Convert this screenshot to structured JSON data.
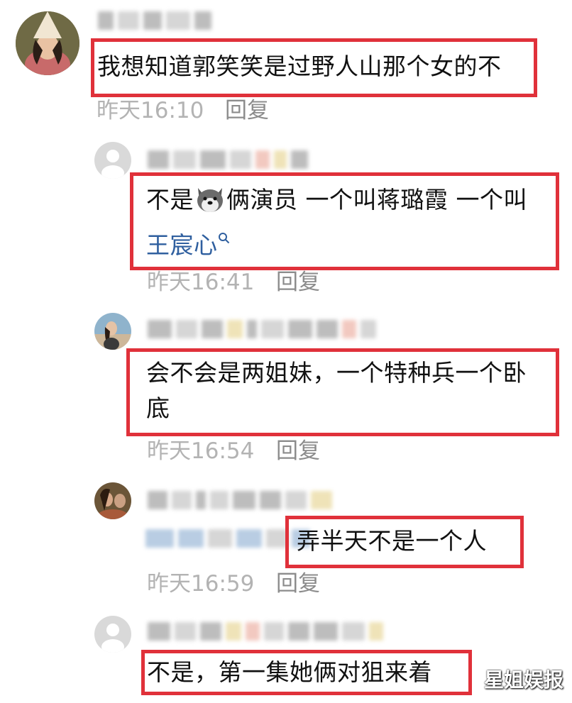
{
  "comments": [
    {
      "text": "我想知道郭笑笑是过野人山那个女的不",
      "time": "昨天16:10",
      "reply": "回复"
    },
    {
      "text_before_emoji": "不是",
      "text_after_emoji": "俩演员 一个叫蒋璐霞 一个叫",
      "link": "王宸心",
      "search_icon": "search-icon",
      "emoji_icon": "dog-face-emoji",
      "time": "昨天16:41",
      "reply": "回复"
    },
    {
      "line1": "会不会是两姐妹，一个特种兵一个卧",
      "line2": "底",
      "time": "昨天16:54",
      "reply": "回复"
    },
    {
      "text": "弄半天不是一个人",
      "time": "昨天16:59",
      "reply": "回复"
    },
    {
      "text": "不是，第一集她俩对狙来着"
    }
  ],
  "watermark": "星姐娱报",
  "colors": {
    "highlight_border": "#e0313a",
    "link": "#2f5f9f",
    "meta": "#b3b3b3"
  }
}
